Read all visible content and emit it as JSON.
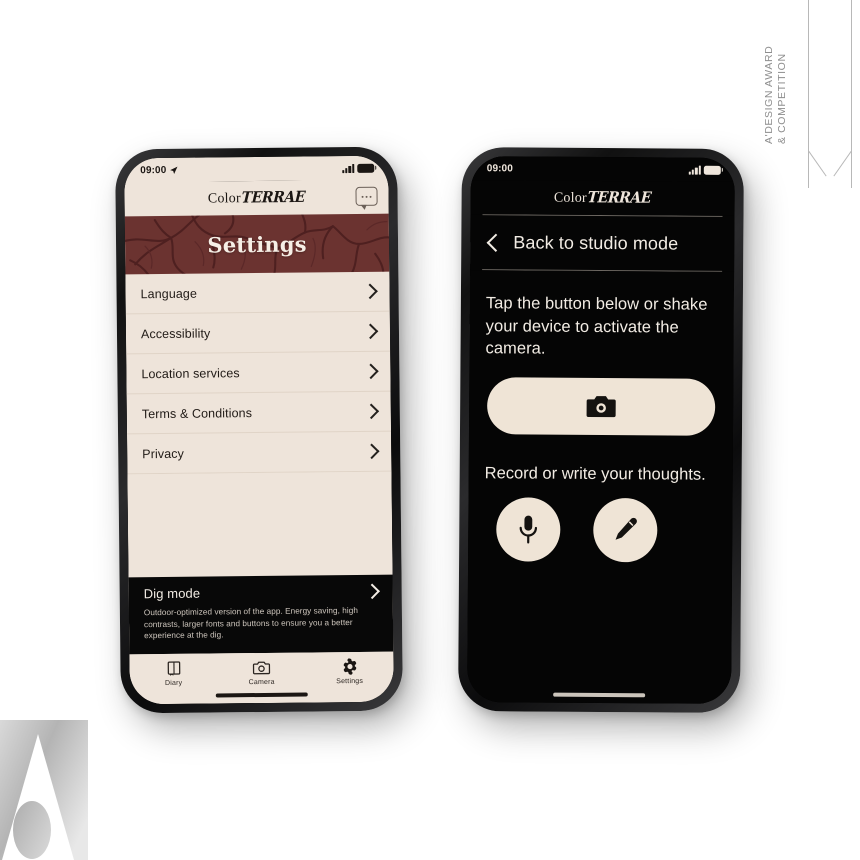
{
  "award_badge": {
    "line1": "A'DESIGN AWARD",
    "line2": "& COMPETITION"
  },
  "brand_mark": {
    "name": "a-design-award-a-mark"
  },
  "colors": {
    "cream": "#EEE4DA",
    "button_cream": "#EFE4D6",
    "maroon": "#6B3330",
    "ink": "#1b1613",
    "dark_panel": "#080808",
    "page_background": "#ffffff"
  },
  "phone_left": {
    "status_bar": {
      "time": "09:00",
      "location_icon": "location-arrow-icon",
      "signal_icon": "cellular-signal-icon",
      "battery_icon": "battery-icon"
    },
    "app_header": {
      "logo_part1": "Color",
      "logo_part2": "TERRAE",
      "chat_button": "chat-bubble-icon"
    },
    "hero": {
      "title": "Settings"
    },
    "settings_items": [
      {
        "label": "Language"
      },
      {
        "label": "Accessibility"
      },
      {
        "label": "Location services"
      },
      {
        "label": "Terms & Conditions"
      },
      {
        "label": "Privacy"
      }
    ],
    "dig_mode": {
      "title": "Dig mode",
      "description": "Outdoor-optimized version of the app. Energy saving, high contrasts, larger fonts and buttons to ensure you a better experience at the dig."
    },
    "tabs": [
      {
        "label": "Diary",
        "icon": "book-icon",
        "active": false
      },
      {
        "label": "Camera",
        "icon": "camera-icon",
        "active": false
      },
      {
        "label": "Settings",
        "icon": "gear-icon",
        "active": true
      }
    ]
  },
  "phone_right": {
    "status_bar": {
      "time": "09:00",
      "signal_icon": "cellular-signal-icon",
      "battery_icon": "battery-icon"
    },
    "app_header": {
      "logo_part1": "Color",
      "logo_part2": "TERRAE"
    },
    "back_nav": {
      "label": "Back to studio mode",
      "icon": "chevron-left-icon"
    },
    "instruction_camera": "Tap the button below or shake your device to activate the camera.",
    "camera_button": {
      "icon": "camera-icon"
    },
    "instruction_record": "Record or write your thoughts.",
    "record_button": {
      "icon": "microphone-icon"
    },
    "write_button": {
      "icon": "pencil-icon"
    }
  }
}
